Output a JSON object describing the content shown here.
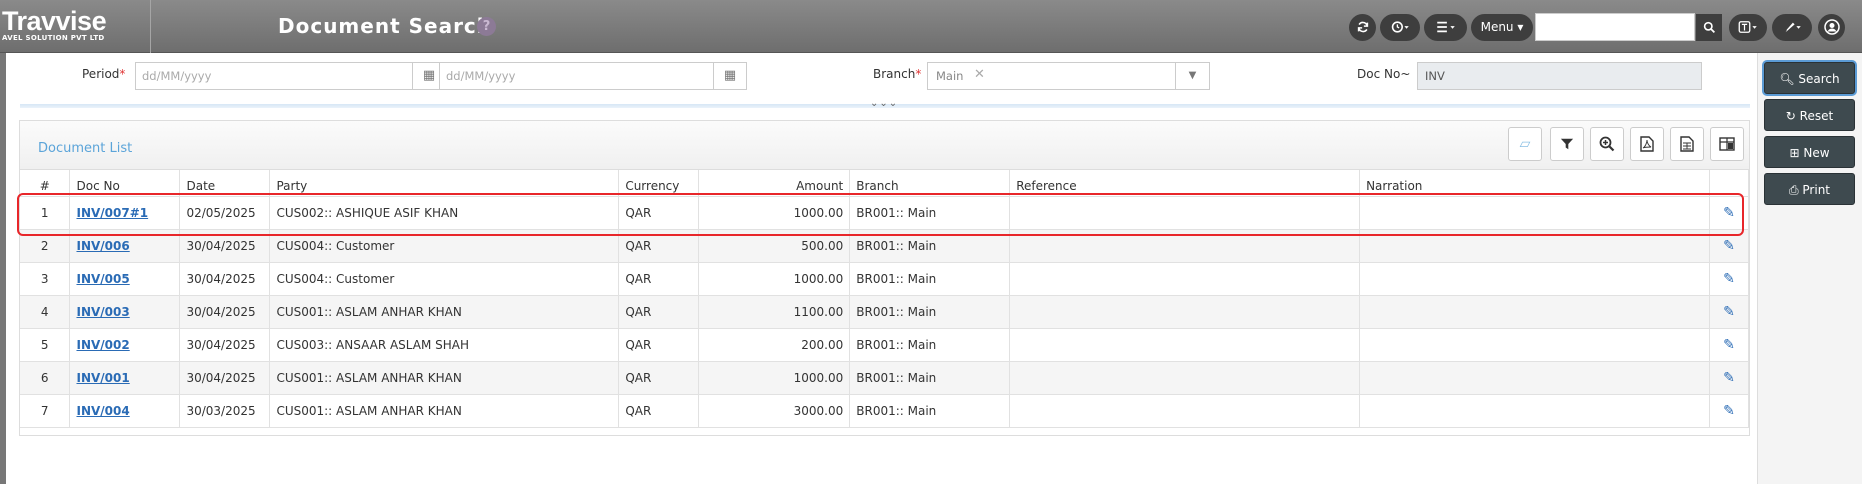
{
  "header": {
    "brand": "Travvise",
    "brand_sub": "AVEL SOLUTION PVT LTD",
    "title": "Document Search",
    "help": "?",
    "menu_label": "Menu ▾",
    "search_placeholder": ""
  },
  "filters": {
    "period_label": "Period",
    "period_from_placeholder": "dd/MM/yyyy",
    "period_to_placeholder": "dd/MM/yyyy",
    "branch_label": "Branch",
    "branch_value": "Main",
    "docno_label": "Doc No~",
    "docno_value": "INV",
    "required_mark": "*"
  },
  "side_actions": {
    "search": "Search",
    "reset": "Reset",
    "new": "New",
    "print": "Print"
  },
  "list": {
    "title": "Document List",
    "columns": [
      "#",
      "Doc No",
      "Date",
      "Party",
      "Currency",
      "Amount",
      "Branch",
      "Reference",
      "Narration"
    ],
    "rows": [
      {
        "idx": "1",
        "doc": "INV/007#1",
        "date": "02/05/2025",
        "party": "CUS002:: ASHIQUE ASIF KHAN",
        "currency": "QAR",
        "amount": "1000.00",
        "branch": "BR001:: Main",
        "reference": "",
        "narration": ""
      },
      {
        "idx": "2",
        "doc": "INV/006",
        "date": "30/04/2025",
        "party": "CUS004:: Customer",
        "currency": "QAR",
        "amount": "500.00",
        "branch": "BR001:: Main",
        "reference": "",
        "narration": ""
      },
      {
        "idx": "3",
        "doc": "INV/005",
        "date": "30/04/2025",
        "party": "CUS004:: Customer",
        "currency": "QAR",
        "amount": "1000.00",
        "branch": "BR001:: Main",
        "reference": "",
        "narration": ""
      },
      {
        "idx": "4",
        "doc": "INV/003",
        "date": "30/04/2025",
        "party": "CUS001:: ASLAM ANHAR KHAN",
        "currency": "QAR",
        "amount": "1100.00",
        "branch": "BR001:: Main",
        "reference": "",
        "narration": ""
      },
      {
        "idx": "5",
        "doc": "INV/002",
        "date": "30/04/2025",
        "party": "CUS003:: ANSAAR ASLAM SHAH",
        "currency": "QAR",
        "amount": "200.00",
        "branch": "BR001:: Main",
        "reference": "",
        "narration": ""
      },
      {
        "idx": "6",
        "doc": "INV/001",
        "date": "30/04/2025",
        "party": "CUS001:: ASLAM ANHAR KHAN",
        "currency": "QAR",
        "amount": "1000.00",
        "branch": "BR001:: Main",
        "reference": "",
        "narration": ""
      },
      {
        "idx": "7",
        "doc": "INV/004",
        "date": "30/03/2025",
        "party": "CUS001:: ASLAM ANHAR KHAN",
        "currency": "QAR",
        "amount": "3000.00",
        "branch": "BR001:: Main",
        "reference": "",
        "narration": ""
      }
    ]
  },
  "colors": {
    "accent": "#2a6bb5",
    "highlight": "#e8262a",
    "topbar": "#7a7a7a"
  }
}
